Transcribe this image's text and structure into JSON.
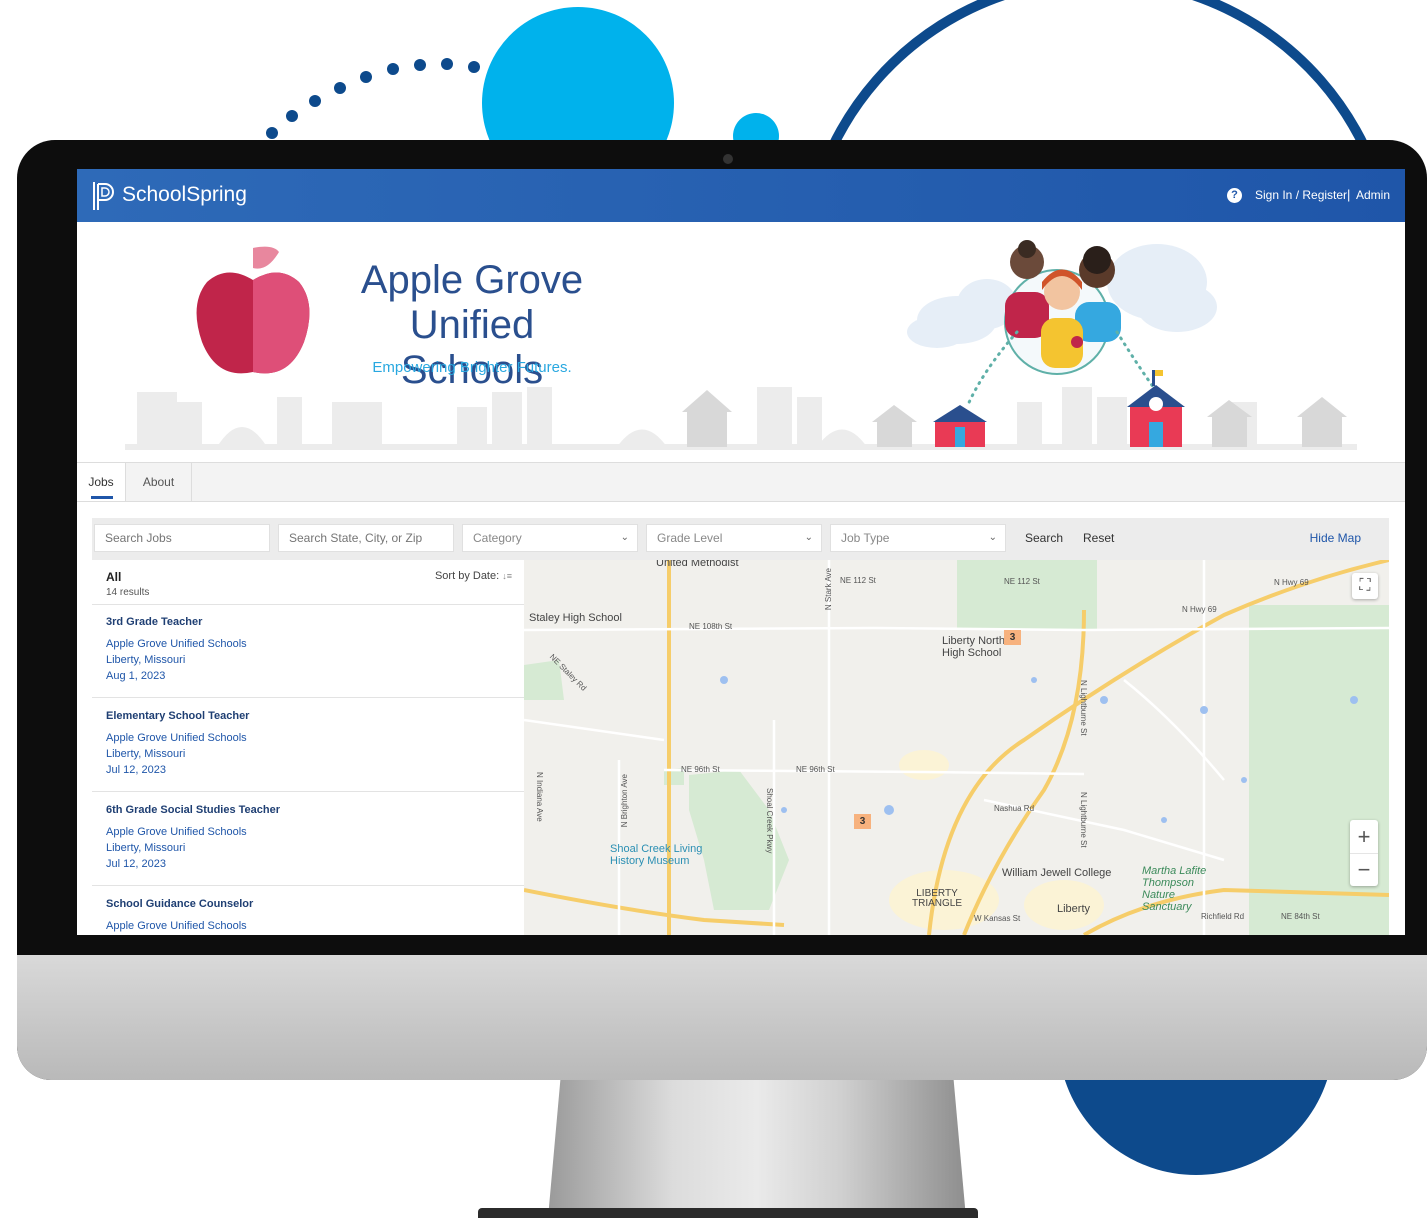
{
  "app": {
    "brand": "SchoolSpring"
  },
  "nav": {
    "help_icon": "?",
    "signin_label": "Sign In / Register",
    "separator": "|",
    "admin_label": "Admin"
  },
  "banner": {
    "org_name_line1": "Apple Grove",
    "org_name_line2": "Unified Schools",
    "tagline": "Empowering Brighter Futures."
  },
  "tabs": [
    {
      "label": "Jobs",
      "active": true
    },
    {
      "label": "About",
      "active": false
    }
  ],
  "filters": {
    "search_jobs_placeholder": "Search Jobs",
    "location_placeholder": "Search State, City, or Zip",
    "category": "Category",
    "grade_level": "Grade Level",
    "job_type": "Job Type",
    "search_label": "Search",
    "reset_label": "Reset",
    "hide_map_label": "Hide Map"
  },
  "results": {
    "filter_label": "All",
    "count_text": "14 results",
    "sort_label": "Sort by Date:",
    "jobs": [
      {
        "title": "3rd Grade Teacher",
        "org": "Apple Grove Unified Schools",
        "location": "Liberty, Missouri",
        "date": "Aug 1, 2023"
      },
      {
        "title": "Elementary School Teacher",
        "org": "Apple Grove Unified Schools",
        "location": "Liberty, Missouri",
        "date": "Jul 12, 2023"
      },
      {
        "title": "6th Grade Social Studies Teacher",
        "org": "Apple Grove Unified Schools",
        "location": "Liberty, Missouri",
        "date": "Jul 12, 2023"
      },
      {
        "title": "School Guidance Counselor",
        "org": "Apple Grove Unified Schools",
        "location": "",
        "date": ""
      }
    ]
  },
  "map": {
    "labels": {
      "united_methodist": "United Methodist",
      "staley": "Staley High School",
      "liberty_north_1": "Liberty North",
      "liberty_north_2": "High School",
      "shoal_1": "Shoal Creek Living",
      "shoal_2": "History Museum",
      "william_jewell": "William Jewell College",
      "martha_1": "Martha Lafite",
      "martha_2": "Thompson",
      "martha_3": "Nature",
      "martha_4": "Sanctuary",
      "liberty_triangle_1": "LIBERTY",
      "liberty_triangle_2": "TRIANGLE",
      "liberty": "Liberty"
    },
    "streets": {
      "ne112_a": "NE 112 St",
      "ne112_b": "NE 112 St",
      "ne108": "NE 108th St",
      "ne96_a": "NE 96th St",
      "ne96_b": "NE 96th St",
      "nhwy69_a": "N Hwy 69",
      "nhwy69_b": "N Hwy 69",
      "nstark": "N Stark Ave",
      "nestaley": "NE Staley Rd",
      "nindiana": "N Indiana Ave",
      "nbrighton": "N Brighton Ave",
      "shoalcreek": "Shoal Creek Pkwy",
      "nlightburne_a": "N Lightburne St",
      "nlightburne_b": "N Lightburne St",
      "nashua": "Nashua Rd",
      "wkansas": "W Kansas St",
      "richfield": "Richfield Rd",
      "ne84": "NE 84th St"
    },
    "markers": [
      "3",
      "3"
    ],
    "zoom_in": "+",
    "zoom_out": "−",
    "fullscreen": "⛶"
  },
  "colors": {
    "nav_blue": "#1f56a9",
    "accent_cyan": "#00b2ec",
    "dark_navy": "#0d4a8c",
    "apple_red": "#c0254a"
  }
}
